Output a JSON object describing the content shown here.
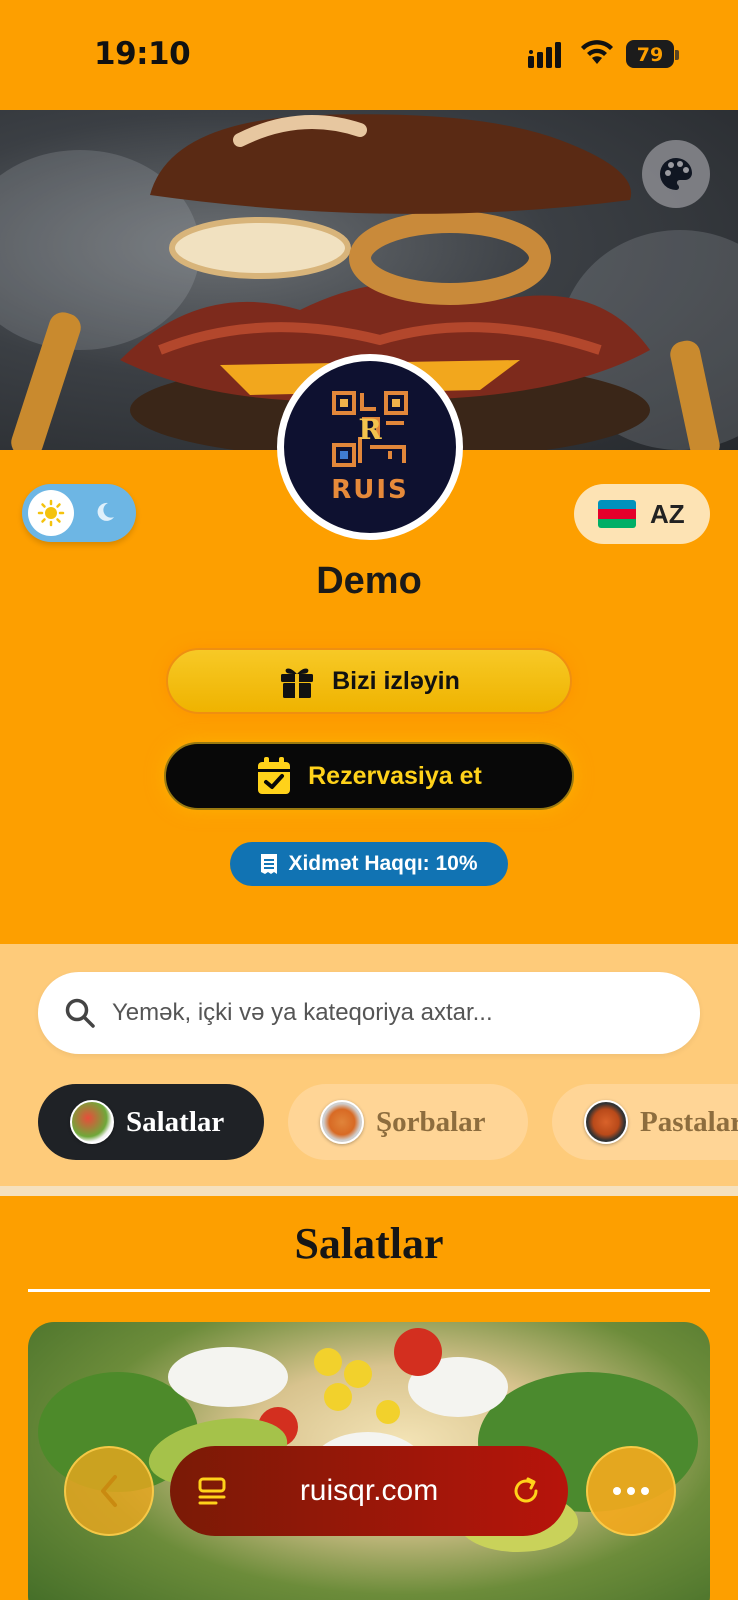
{
  "status_bar": {
    "time": "19:10",
    "battery": "79"
  },
  "restaurant": {
    "logo_text": "RUIS",
    "name": "Demo"
  },
  "language": {
    "code": "AZ",
    "flag_colors": [
      "#0092bc",
      "#e4002b",
      "#00af66"
    ]
  },
  "actions": {
    "follow_label": "Bizi izləyin",
    "reserve_label": "Rezervasiya et"
  },
  "fee": {
    "label": "Xidmət Haqqı: 10%"
  },
  "search": {
    "placeholder": "Yemək, içki və ya kateqoriya axtar..."
  },
  "categories": [
    {
      "label": "Salatlar",
      "active": true
    },
    {
      "label": "Şorbalar",
      "active": false
    },
    {
      "label": "Pastalar",
      "active": false
    }
  ],
  "section": {
    "title": "Salatlar"
  },
  "browser": {
    "url": "ruisqr.com"
  },
  "colors": {
    "background": "#fd9f00",
    "accent_yellow": "#ffd21a",
    "fee_badge": "#1173b3"
  }
}
